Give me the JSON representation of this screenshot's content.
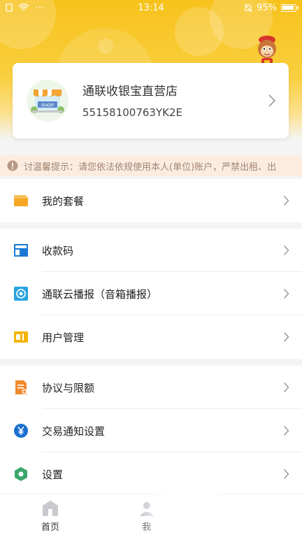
{
  "status_bar": {
    "time": "13:14",
    "battery": "95%",
    "left_icons": [
      "sim-icon",
      "wifi-icon",
      "more-dots-icon"
    ],
    "right_icons": [
      "silent-bell-icon",
      "battery-icon"
    ]
  },
  "store": {
    "logo_text": "SHOP",
    "name": "通联收银宝直营店",
    "id": "55158100763YK2E"
  },
  "notice": {
    "text": "讨温馨提示：请您依法依规使用本人(单位)账户，严禁出租、出"
  },
  "menu_groups": [
    {
      "items": [
        {
          "label": "我的套餐",
          "icon": "package-folder-icon"
        }
      ]
    },
    {
      "items": [
        {
          "label": "收款码",
          "icon": "qrcode-icon"
        },
        {
          "label": "通联云播报（音箱播报）",
          "icon": "speaker-icon"
        },
        {
          "label": "用户管理",
          "icon": "user-card-icon"
        }
      ]
    },
    {
      "items": [
        {
          "label": "协议与限额",
          "icon": "document-icon"
        },
        {
          "label": "交易通知设置",
          "icon": "yuan-coin-icon"
        },
        {
          "label": "设置",
          "icon": "settings-hex-icon"
        }
      ]
    }
  ],
  "tabbar": {
    "tabs": [
      {
        "label": "首页",
        "icon": "home-icon"
      },
      {
        "label": "我",
        "icon": "me-icon"
      }
    ]
  },
  "colors": {
    "header_yellow": "#f7c21b",
    "notice_bg": "#fcece0",
    "blue": "#1a7ad6",
    "orange": "#f08a2b",
    "green": "#3aa86b"
  }
}
